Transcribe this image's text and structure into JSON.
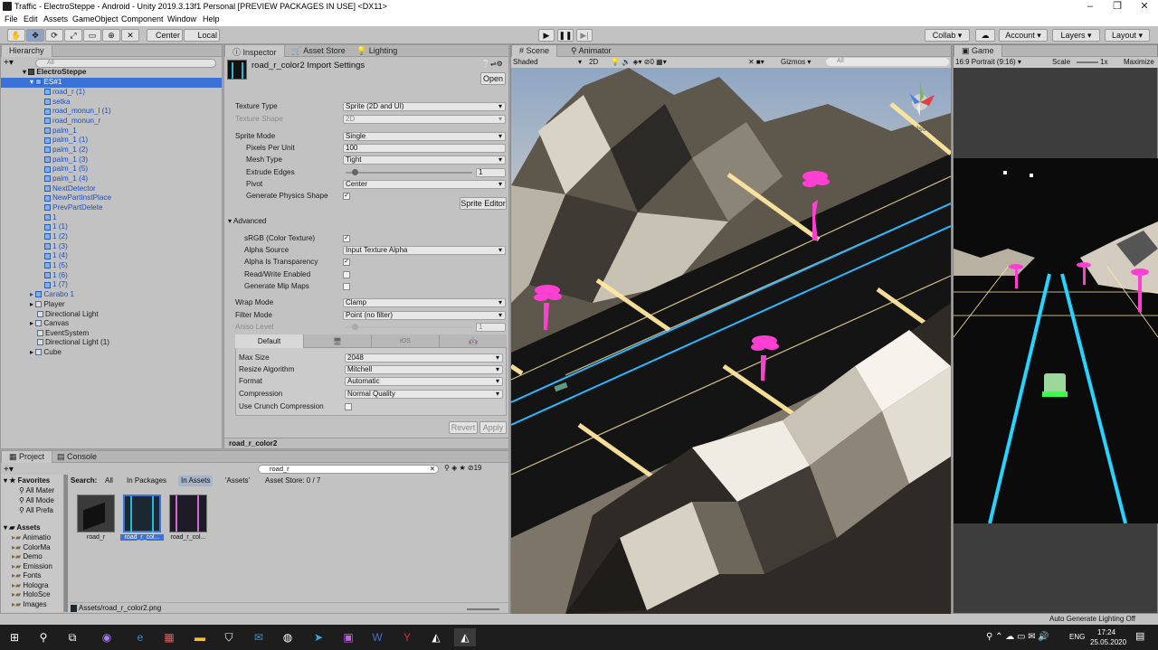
{
  "window": {
    "title": "Traffic - ElectroSteppe - Android - Unity 2019.3.13f1 Personal [PREVIEW PACKAGES IN USE] <DX11>"
  },
  "menu": [
    "File",
    "Edit",
    "Assets",
    "GameObject",
    "Component",
    "Window",
    "Help"
  ],
  "toolbar": {
    "center": "Center",
    "local": "Local",
    "collab": "Collab",
    "account": "Account",
    "layers": "Layers",
    "layout": "Layout"
  },
  "hierarchy": {
    "tab": "Hierarchy",
    "search_placeholder": "All",
    "scene": "ElectroSteppe",
    "root": "ES#1",
    "children": [
      "road_r (1)",
      "setka",
      "road_monun_l (1)",
      "road_monun_r",
      "palm_1",
      "palm_1 (1)",
      "palm_1 (2)",
      "palm_1 (3)",
      "palm_1 (5)",
      "palm_1 (4)",
      "NextDetector",
      "NewPartInstPlace",
      "PrevPartDelete",
      "1",
      "1 (1)",
      "1 (2)",
      "1 (3)",
      "1 (4)",
      "1 (5)",
      "1 (6)",
      "1 (7)"
    ],
    "others": [
      "Carabo 1",
      "Player",
      "Directional Light",
      "Canvas",
      "EventSystem",
      "Directional Light (1)",
      "Cube"
    ]
  },
  "inspector": {
    "tabs": [
      "Inspector",
      "Asset Store",
      "Lighting"
    ],
    "title": "road_r_color2 Import Settings",
    "open": "Open",
    "texture_type": {
      "label": "Texture Type",
      "value": "Sprite (2D and UI)"
    },
    "texture_shape": {
      "label": "Texture Shape",
      "value": "2D"
    },
    "sprite_mode": {
      "label": "Sprite Mode",
      "value": "Single"
    },
    "ppu": {
      "label": "Pixels Per Unit",
      "value": "100"
    },
    "mesh_type": {
      "label": "Mesh Type",
      "value": "Tight"
    },
    "extrude": {
      "label": "Extrude Edges",
      "value": "1",
      "level": 0.07
    },
    "pivot": {
      "label": "Pivot",
      "value": "Center"
    },
    "gen_physics": {
      "label": "Generate Physics Shape"
    },
    "sprite_editor": "Sprite Editor",
    "advanced": "Advanced",
    "srgb": {
      "label": "sRGB (Color Texture)"
    },
    "alpha_source": {
      "label": "Alpha Source",
      "value": "Input Texture Alpha"
    },
    "alpha_transp": {
      "label": "Alpha Is Transparency"
    },
    "rw": {
      "label": "Read/Write Enabled"
    },
    "mips": {
      "label": "Generate Mip Maps"
    },
    "wrap": {
      "label": "Wrap Mode",
      "value": "Clamp"
    },
    "filter": {
      "label": "Filter Mode",
      "value": "Point (no filter)"
    },
    "aniso": {
      "label": "Aniso Level",
      "value": "1"
    },
    "platform_tabs": [
      "Default",
      "iOS"
    ],
    "max_size": {
      "label": "Max Size",
      "value": "2048"
    },
    "resize": {
      "label": "Resize Algorithm",
      "value": "Mitchell"
    },
    "format": {
      "label": "Format",
      "value": "Automatic"
    },
    "compression": {
      "label": "Compression",
      "value": "Normal Quality"
    },
    "crunch": {
      "label": "Use Crunch Compression"
    },
    "revert": "Revert",
    "apply": "Apply",
    "footer": "road_r_color2"
  },
  "scene": {
    "tabs": [
      "Scene",
      "Animator"
    ],
    "shading": "Shaded",
    "mode2d": "2D",
    "hidden_count": "0",
    "gizmos": "Gizmos",
    "search_placeholder": "All",
    "iso": "Iso"
  },
  "game": {
    "tab": "Game",
    "aspect": "16:9 Portrait (9:16)",
    "scale_label": "Scale",
    "scale_value": "1x",
    "maximize": "Maximize"
  },
  "project": {
    "tabs": [
      "Project",
      "Console"
    ],
    "search_value": "road_r",
    "count": "19",
    "favorites": {
      "title": "Favorites",
      "items": [
        "All Mater",
        "All Mode",
        "All Prefa"
      ]
    },
    "assets_tree": {
      "title": "Assets",
      "items": [
        "Animatio",
        "ColorMa",
        "Demo",
        "Emission",
        "Fonts",
        "Hologra",
        "HoloSce",
        "Images"
      ]
    },
    "filter_bar": {
      "search": "Search:",
      "all": "All",
      "in_packages": "In Packages",
      "in_assets": "In Assets",
      "assets_q": "'Assets'",
      "store": "Asset Store: 0 / 7"
    },
    "assets": [
      "road_r",
      "road_r_col...",
      "road_r_col..."
    ],
    "path": "Assets/road_r_color2.png"
  },
  "status": {
    "right": "Auto Generate Lighting Off"
  },
  "taskbar": {
    "lang": "ENG",
    "time": "17:24",
    "date": "25.05.2020"
  },
  "colors": {
    "unity_panel": "#c2c2c2",
    "selection": "#3a72d8",
    "neon_pink": "#ff3fd2",
    "neon_cyan": "#22c8ff",
    "road_yellow": "#ffe69a"
  }
}
